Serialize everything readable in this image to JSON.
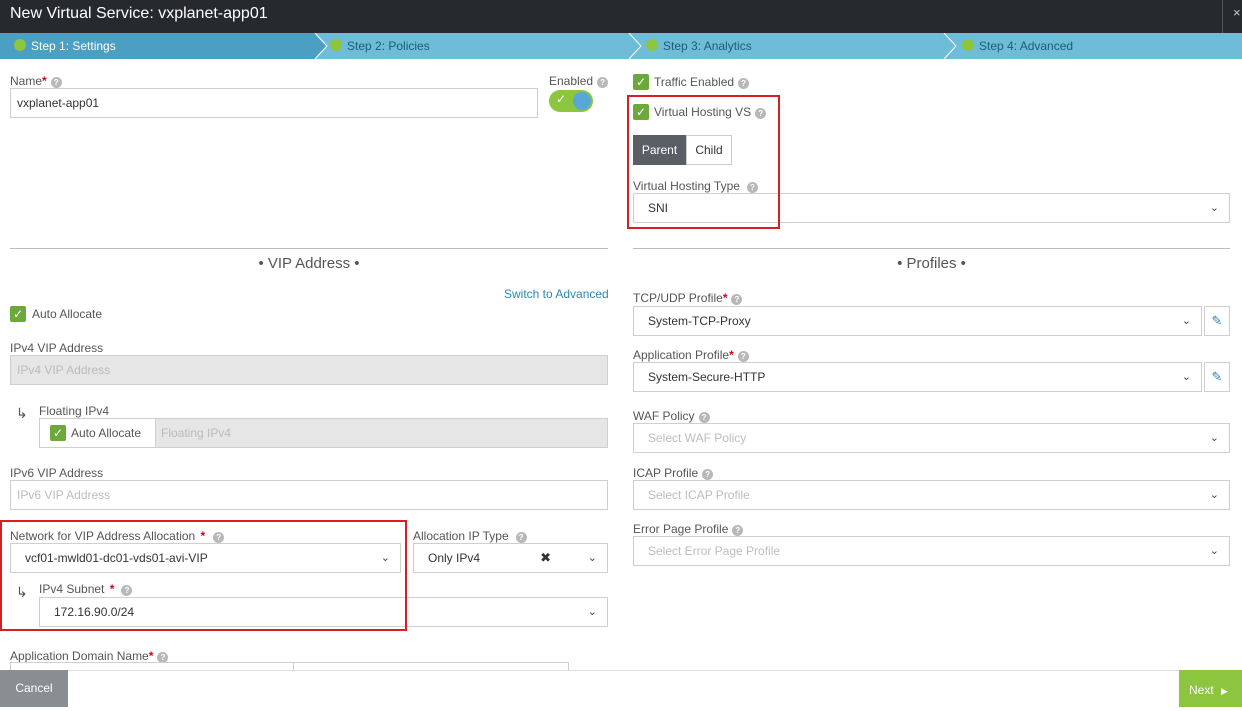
{
  "window": {
    "title": "New Virtual Service: vxplanet-app01",
    "close_glyph": "×"
  },
  "steps": [
    {
      "label": "Step 1: Settings"
    },
    {
      "label": "Step 2: Policies"
    },
    {
      "label": "Step 3: Analytics"
    },
    {
      "label": "Step 4: Advanced"
    }
  ],
  "settings": {
    "name_label": "Name",
    "name_value": "vxplanet-app01",
    "enabled_label": "Enabled",
    "enabled": true,
    "traffic_enabled_label": "Traffic Enabled",
    "virtual_hosting_label": "Virtual Hosting VS",
    "vh_parent": "Parent",
    "vh_child": "Child",
    "vh_type_label": "Virtual Hosting Type",
    "vh_type_value": "SNI"
  },
  "vip": {
    "title": "• VIP Address •",
    "switch_link": "Switch to Advanced",
    "auto_allocate_label": "Auto Allocate",
    "ipv4_label": "IPv4 VIP Address",
    "ipv4_placeholder": "IPv4 VIP Address",
    "floating_label": "Floating IPv4",
    "floating_auto_label": "Auto Allocate",
    "floating_placeholder": "Floating IPv4",
    "ipv6_label": "IPv6 VIP Address",
    "ipv6_placeholder": "IPv6 VIP Address",
    "network_label": "Network for VIP Address Allocation",
    "network_value": "vcf01-mwld01-dc01-vds01-avi-VIP",
    "alloc_type_label": "Allocation IP Type",
    "alloc_type_value": "Only IPv4",
    "subnet_label": "IPv4 Subnet",
    "subnet_value": "172.16.90.0/24",
    "app_domain_label": "Application Domain Name"
  },
  "profiles": {
    "title": "• Profiles •",
    "tcp_label": "TCP/UDP Profile",
    "tcp_value": "System-TCP-Proxy",
    "app_label": "Application Profile",
    "app_value": "System-Secure-HTTP",
    "waf_label": "WAF Policy",
    "waf_placeholder": "Select WAF Policy",
    "icap_label": "ICAP Profile",
    "icap_placeholder": "Select ICAP Profile",
    "error_label": "Error Page Profile",
    "error_placeholder": "Select Error Page Profile"
  },
  "footer": {
    "cancel": "Cancel",
    "next": "Next"
  },
  "colors": {
    "accent_green": "#8cc63f",
    "step_blue": "#6ebcd7",
    "highlight_red": "#d81e24"
  }
}
